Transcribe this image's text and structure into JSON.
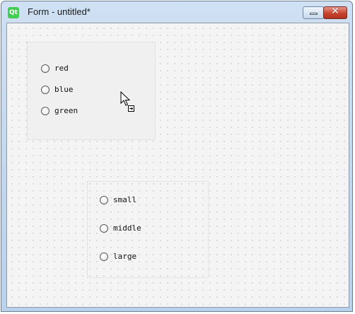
{
  "window": {
    "title": "Form - untitled*",
    "icon_text": "Qt",
    "close_glyph": "✕"
  },
  "group_top": {
    "radios": [
      {
        "label": "red",
        "checked": false
      },
      {
        "label": "blue",
        "checked": false
      },
      {
        "label": "green",
        "checked": false
      }
    ]
  },
  "group_bottom": {
    "radios": [
      {
        "label": "small",
        "checked": false
      },
      {
        "label": "middle",
        "checked": false
      },
      {
        "label": "large",
        "checked": false
      }
    ]
  },
  "icons": {
    "app": "qt-designer-icon",
    "minimize": "minimize-icon",
    "close": "close-icon",
    "cursor": "mouse-pointer-icon",
    "drag_badge": "drag-move-icon"
  },
  "colors": {
    "title_gradient_top": "#cfe0f3",
    "close_button": "#c8432f",
    "grid_dot": "#8a8a8a",
    "form_background": "#f4f4f4"
  }
}
